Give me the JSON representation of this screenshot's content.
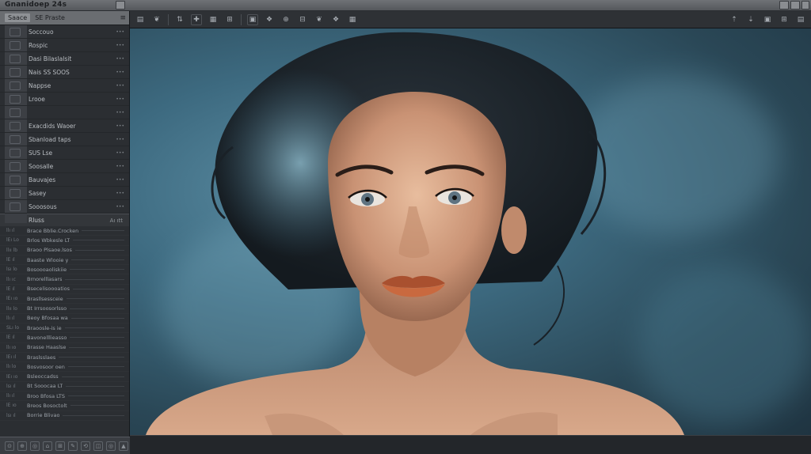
{
  "app": {
    "title": "Gnanidoep 24s"
  },
  "sidebar": {
    "header_chip": "Saace",
    "header_label": "SE Praste",
    "header_menu": "≡",
    "menu_items": [
      {
        "label": "Soccouo"
      },
      {
        "label": "Rospic"
      },
      {
        "label": "Dasi Bilaslalsit"
      },
      {
        "label": "Nais SS SOOS"
      },
      {
        "label": "Nappse"
      },
      {
        "label": "Lrooe"
      },
      {
        "label": ""
      },
      {
        "label": "Exacdids Waoer"
      },
      {
        "label": "Sbanload taps"
      },
      {
        "label": "SUS Lse"
      },
      {
        "label": "Soosalle"
      },
      {
        "label": "Bauvajes"
      },
      {
        "label": "Sasey"
      },
      {
        "label": "Sooosous"
      }
    ],
    "sub_header": {
      "label": "Rluss",
      "meta": "Aı ıtt"
    },
    "layers": [
      {
        "num": "llı ıl",
        "label": "Brace Bblie.Crocken"
      },
      {
        "num": "lEı Lo",
        "label": "Brlos Wbkesle LT"
      },
      {
        "num": "llıı lb",
        "label": "Braoo Plsaoe.lsos"
      },
      {
        "num": "lE ıl",
        "label": "Baaste Wlooie y"
      },
      {
        "num": "lsı lo",
        "label": "Bosoooaoliskiie"
      },
      {
        "num": "llı ıc",
        "label": "Brnorelllasars"
      },
      {
        "num": "lE ıl",
        "label": "Bsecelisoooatios"
      },
      {
        "num": "lEı ıo",
        "label": "Brasllsessceie"
      },
      {
        "num": "llıı lo",
        "label": "Bt Irrsoosorlsso"
      },
      {
        "num": "llı ıl",
        "label": "Beoy Bfosaa wa"
      },
      {
        "num": "SLı lo",
        "label": "Braoosle-is ie"
      },
      {
        "num": "lE ıl",
        "label": "Bavonelllieasso"
      },
      {
        "num": "llı ıo",
        "label": "Brasse Haaslse"
      },
      {
        "num": "lEı ıl",
        "label": "Braslsslaes"
      },
      {
        "num": "llı lo",
        "label": "Bosvosoor oen"
      },
      {
        "num": "lEı ıo",
        "label": "Bsleoccadss"
      },
      {
        "num": "lsı ıl",
        "label": "Bt Sooocaa LT"
      },
      {
        "num": "llı ıl",
        "label": "Broo Bfosa LTS"
      },
      {
        "num": "lE ıo",
        "label": "Breos Bosoctolt"
      },
      {
        "num": "lsı ıl",
        "label": "Borrie Blivao"
      }
    ],
    "footer_buttons": [
      "⊙",
      "⊕",
      "◎",
      "⌂",
      "⊞",
      "✎",
      "⟲",
      "◫",
      "◎",
      "▲"
    ]
  },
  "toolbar": {
    "left_tools": [
      "▤",
      "❦",
      "⇅",
      "✚",
      "▦",
      "⊞",
      "▣",
      "❖",
      "⊕",
      "⊟",
      "❦",
      "❖",
      "▦"
    ],
    "right_tools": [
      "⇡",
      "⇣",
      "▣",
      "⊞",
      "▤"
    ]
  },
  "canvas": {
    "image_subject": "portrait-photo",
    "colors": {
      "background": "#3d6a80",
      "skin": "#d9a98a",
      "hair": "#1b2228",
      "lips": "#c0603c"
    }
  }
}
